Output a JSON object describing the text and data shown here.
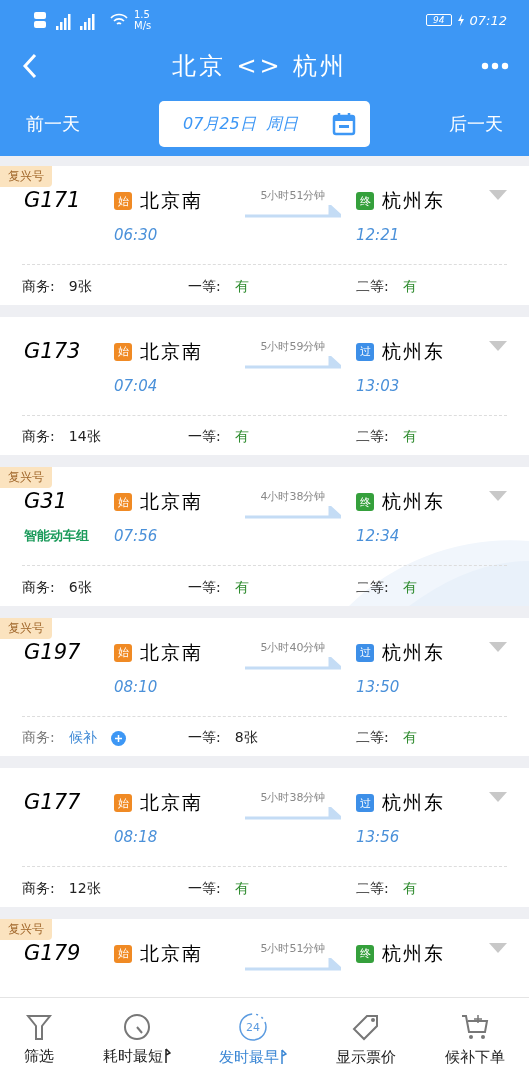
{
  "status_bar": {
    "speed": "1.5",
    "speed_unit": "M/s",
    "battery": "94",
    "time": "07:12"
  },
  "nav": {
    "title": "北京 <> 杭州"
  },
  "date_bar": {
    "prev": "前一天",
    "date": "07月25日  周日",
    "next": "后一天"
  },
  "trains": [
    {
      "tag": "复兴号",
      "number": "G171",
      "from": {
        "badge": "始",
        "kind": "start",
        "name": "北京南",
        "time": "06:30"
      },
      "duration": "5小时51分钟",
      "to": {
        "badge": "终",
        "kind": "end",
        "name": "杭州东",
        "time": "12:21"
      },
      "seats": [
        {
          "label": "商务:",
          "value": "9张",
          "kind": "count"
        },
        {
          "label": "一等:",
          "value": "有",
          "kind": "available"
        },
        {
          "label": "二等:",
          "value": "有",
          "kind": "available"
        }
      ]
    },
    {
      "number": "G173",
      "from": {
        "badge": "始",
        "kind": "start",
        "name": "北京南",
        "time": "07:04"
      },
      "duration": "5小时59分钟",
      "to": {
        "badge": "过",
        "kind": "pass",
        "name": "杭州东",
        "time": "13:03"
      },
      "seats": [
        {
          "label": "商务:",
          "value": "14张",
          "kind": "count"
        },
        {
          "label": "一等:",
          "value": "有",
          "kind": "available"
        },
        {
          "label": "二等:",
          "value": "有",
          "kind": "available"
        }
      ]
    },
    {
      "tag": "复兴号",
      "number": "G31",
      "logo": "智能动车组",
      "from": {
        "badge": "始",
        "kind": "start",
        "name": "北京南",
        "time": "07:56"
      },
      "duration": "4小时38分钟",
      "to": {
        "badge": "终",
        "kind": "end",
        "name": "杭州东",
        "time": "12:34"
      },
      "seats": [
        {
          "label": "商务:",
          "value": "6张",
          "kind": "count"
        },
        {
          "label": "一等:",
          "value": "有",
          "kind": "available"
        },
        {
          "label": "二等:",
          "value": "有",
          "kind": "available"
        }
      ]
    },
    {
      "tag": "复兴号",
      "number": "G197",
      "from": {
        "badge": "始",
        "kind": "start",
        "name": "北京南",
        "time": "08:10"
      },
      "duration": "5小时40分钟",
      "to": {
        "badge": "过",
        "kind": "pass",
        "name": "杭州东",
        "time": "13:50"
      },
      "seats": [
        {
          "label": "商务:",
          "value": "候补",
          "kind": "waitlist"
        },
        {
          "label": "一等:",
          "value": "8张",
          "kind": "count"
        },
        {
          "label": "二等:",
          "value": "有",
          "kind": "available"
        }
      ]
    },
    {
      "number": "G177",
      "from": {
        "badge": "始",
        "kind": "start",
        "name": "北京南",
        "time": "08:18"
      },
      "duration": "5小时38分钟",
      "to": {
        "badge": "过",
        "kind": "pass",
        "name": "杭州东",
        "time": "13:56"
      },
      "seats": [
        {
          "label": "商务:",
          "value": "12张",
          "kind": "count"
        },
        {
          "label": "一等:",
          "value": "有",
          "kind": "available"
        },
        {
          "label": "二等:",
          "value": "有",
          "kind": "available"
        }
      ]
    },
    {
      "tag": "复兴号",
      "number": "G179",
      "from": {
        "badge": "始",
        "kind": "start",
        "name": "北京南"
      },
      "duration": "5小时51分钟",
      "to": {
        "badge": "终",
        "kind": "end",
        "name": "杭州东"
      }
    }
  ],
  "bottom_tabs": [
    {
      "kind": "filter",
      "label": "筛选",
      "selected": false
    },
    {
      "kind": "timer",
      "label": "耗时最短",
      "sortable": true,
      "selected": false
    },
    {
      "kind": "clock",
      "label": "发时最早",
      "icon_text": "24",
      "sortable": true,
      "selected": true
    },
    {
      "kind": "price",
      "label": "显示票价",
      "selected": false
    },
    {
      "kind": "cart",
      "label": "候补下单",
      "selected": false
    }
  ]
}
